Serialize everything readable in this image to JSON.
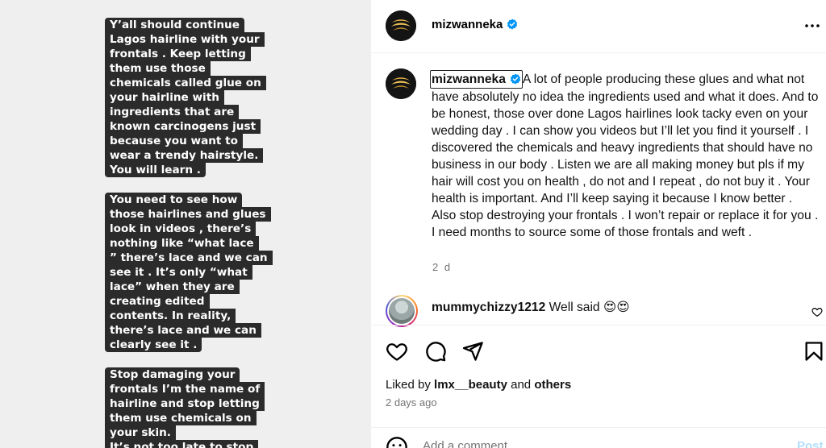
{
  "story": {
    "blocks": [
      {
        "lines": [
          "Y’all should continue",
          "Lagos hairline with your",
          "frontals . Keep letting",
          "them use those",
          "chemicals called glue on",
          "your hairline with",
          "ingredients that are",
          "known carcinogens just",
          "because you want to",
          "wear a trendy hairstyle.",
          "You will learn ."
        ]
      },
      {
        "lines": [
          "You need to see how",
          "those hairlines and glues",
          "look in videos , there’s",
          "nothing like “what lace",
          "” there’s lace and we can",
          "see it . It’s only “what",
          "lace” when they are",
          "creating edited",
          "contents. In reality,",
          "there’s lace and we can",
          "clearly see it ."
        ]
      },
      {
        "lines": [
          "Stop damaging your",
          "frontals I’m the name of",
          "hairline and stop letting",
          "them use chemicals on",
          "your skin.",
          "It’s not too late to stop"
        ]
      }
    ]
  },
  "post": {
    "username": "mizwanneka",
    "caption_username": "mizwanneka",
    "caption": "A lot of people producing these glues and what not have absolutely no idea the ingredients used and what it does. And to be honest, those over done Lagos hairlines look tacky even on your wedding day . I can show you videos but I’ll let you find it yourself . I discovered the chemicals and heavy ingredients that should have no business in our body . Listen we are all making money but pls if my hair will cost you on health , do not and I repeat , do not buy it . Your health is important. And I’ll keep saying it because I know better . Also stop destroying your frontals . I won’t repair or replace it for you . I need months to source some of those frontals and weft .",
    "caption_time": "2 d",
    "comment": {
      "username": "mummychizzy1212",
      "text": "Well said 😍😍"
    },
    "likes": {
      "prefix": "Liked by",
      "user": "lmx__beauty",
      "and": "and",
      "others": "others"
    },
    "time": "2 days ago",
    "add_comment_placeholder": "Add a comment…",
    "post_label": "Post"
  },
  "icons": {
    "verified": "verified-badge-icon",
    "more": "more-options-icon",
    "like": "heart-icon",
    "comment": "comment-bubble-icon",
    "share": "paper-plane-icon",
    "save": "bookmark-icon",
    "emoji": "smiley-icon"
  },
  "colors": {
    "verified": "#0095f6",
    "muted": "#737373",
    "post_disabled": "#b2dffc"
  }
}
